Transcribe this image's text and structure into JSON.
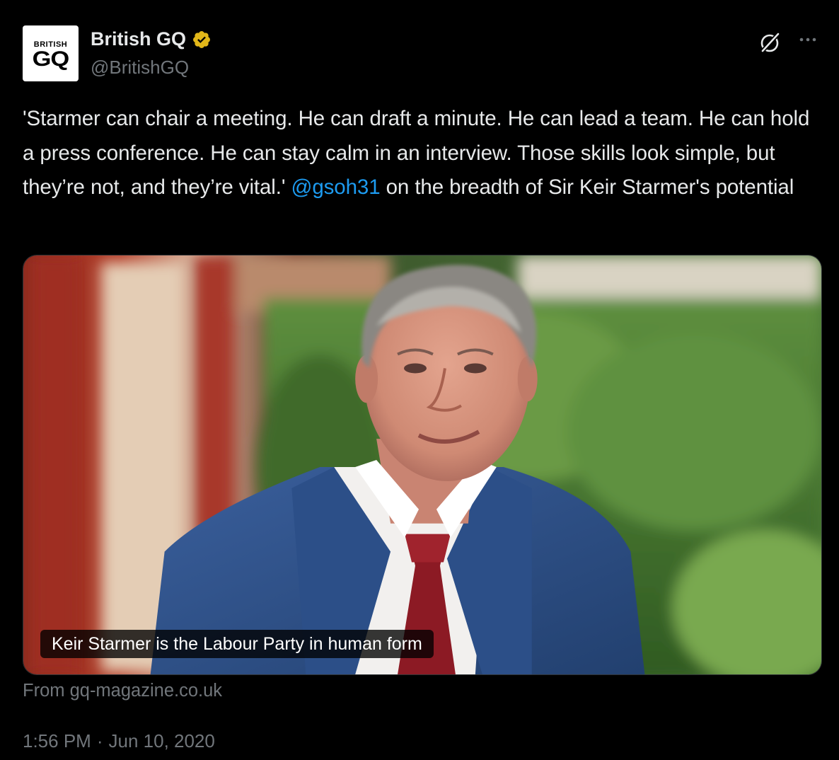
{
  "author": {
    "avatar_top": "BRITISH",
    "avatar_logo": "GQ",
    "display_name": "British GQ",
    "handle": "@BritishGQ",
    "verified_color": "#e2b719"
  },
  "tweet": {
    "text_before_mention": "'Starmer can chair a meeting. He can draft a minute. He can lead a team. He can hold a press conference. He can stay calm in an interview. Those skills look simple, but they’re not, and they’re vital.' ",
    "mention": "@gsoh31",
    "text_after_mention": " on the breadth of Sir Keir Starmer's potential",
    "mention_color": "#1d9bf0"
  },
  "card": {
    "caption": "Keir Starmer is the Labour Party in human form",
    "source": "From gq-magazine.co.uk"
  },
  "meta": {
    "time": "1:56 PM",
    "separator": "·",
    "date": "Jun 10, 2020"
  },
  "icons": {
    "grok": "grok-icon",
    "more": "more-icon",
    "verified": "verified-badge-icon"
  }
}
